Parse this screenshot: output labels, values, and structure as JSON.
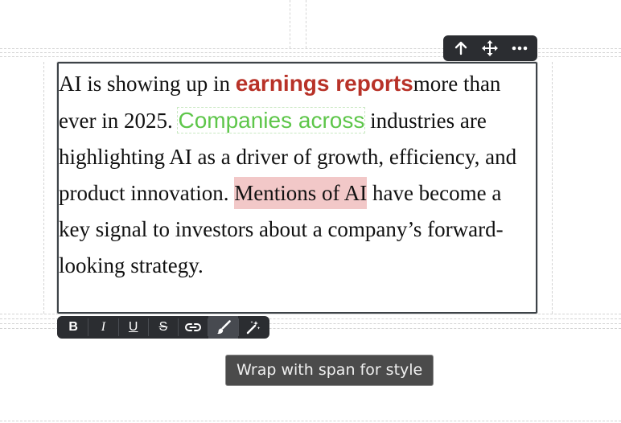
{
  "block_toolbar": {
    "move_up_icon": "arrow-up",
    "drag_icon": "move-arrows",
    "more_icon": "ellipsis"
  },
  "paragraph": {
    "text_1": "AI is showing up in ",
    "red_span": "earnings reports",
    "text_2": "more than ever in 2025. ",
    "green_span": "Companies across",
    "text_3": " industries are highlighting AI as a driver of growth, efficiency, and product innovation. ",
    "pink_span": "Mentions of AI",
    "text_4": " have become a key signal to investors about a company’s forward-looking strategy.",
    "colors": {
      "red": "#b83228",
      "green": "#5ec64a",
      "pink_bg": "#f2c8c8"
    }
  },
  "format_toolbar": {
    "bold": "B",
    "italic": "I",
    "underline": "U",
    "strikethrough": "S",
    "link_icon": "link",
    "style_icon": "paintbrush",
    "clear_icon": "magic-wand"
  },
  "tooltip": {
    "text": "Wrap with span for style"
  }
}
